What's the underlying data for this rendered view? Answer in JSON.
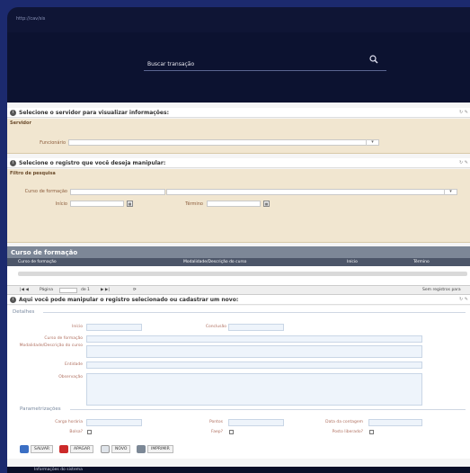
{
  "browser": {
    "url": "http://cav/sis"
  },
  "search": {
    "label": "Buscar transação"
  },
  "section1": {
    "title": "Selecione o servidor para visualizar informações:",
    "panel_title": "Servidor",
    "funcionario_label": "Funcionário"
  },
  "section2": {
    "title": "Selecione o registro que você deseja manipular:",
    "panel_title": "Filtro de pesquisa",
    "curso_label": "Curso de formação",
    "inicio_label": "Início",
    "termino_label": "Término"
  },
  "grid": {
    "title": "Curso de formação",
    "columns": [
      "Curso de formação",
      "Modalidade/Descrição do curso",
      "Início",
      "Término"
    ],
    "pager": {
      "page_label": "Página",
      "of_label": "de 1",
      "status": "Sem registros para"
    }
  },
  "section3": {
    "title": "Aqui você pode manipular o registro selecionado ou cadastrar um novo:",
    "group_details": "Detalhes",
    "inicio": "Início",
    "conclusao": "Conclusão",
    "curso": "Curso de formação",
    "modalidade": "Modalidade/Descrição do curso",
    "entidade": "Entidade",
    "observacao": "Observação",
    "group_params": "Parametrizações",
    "carga": "Carga horária",
    "pontos": "Pontos",
    "data_contagem": "Data da contagem",
    "bolsa": "Bolsa?",
    "faep": "Faep?",
    "posto": "Posto liberado?"
  },
  "buttons": {
    "salvar": "SALVAR",
    "apagar": "APAGAR",
    "novo": "NOVO",
    "imprimir": "IMPRIMIR"
  },
  "footer": {
    "text": "Informações do sistema"
  }
}
